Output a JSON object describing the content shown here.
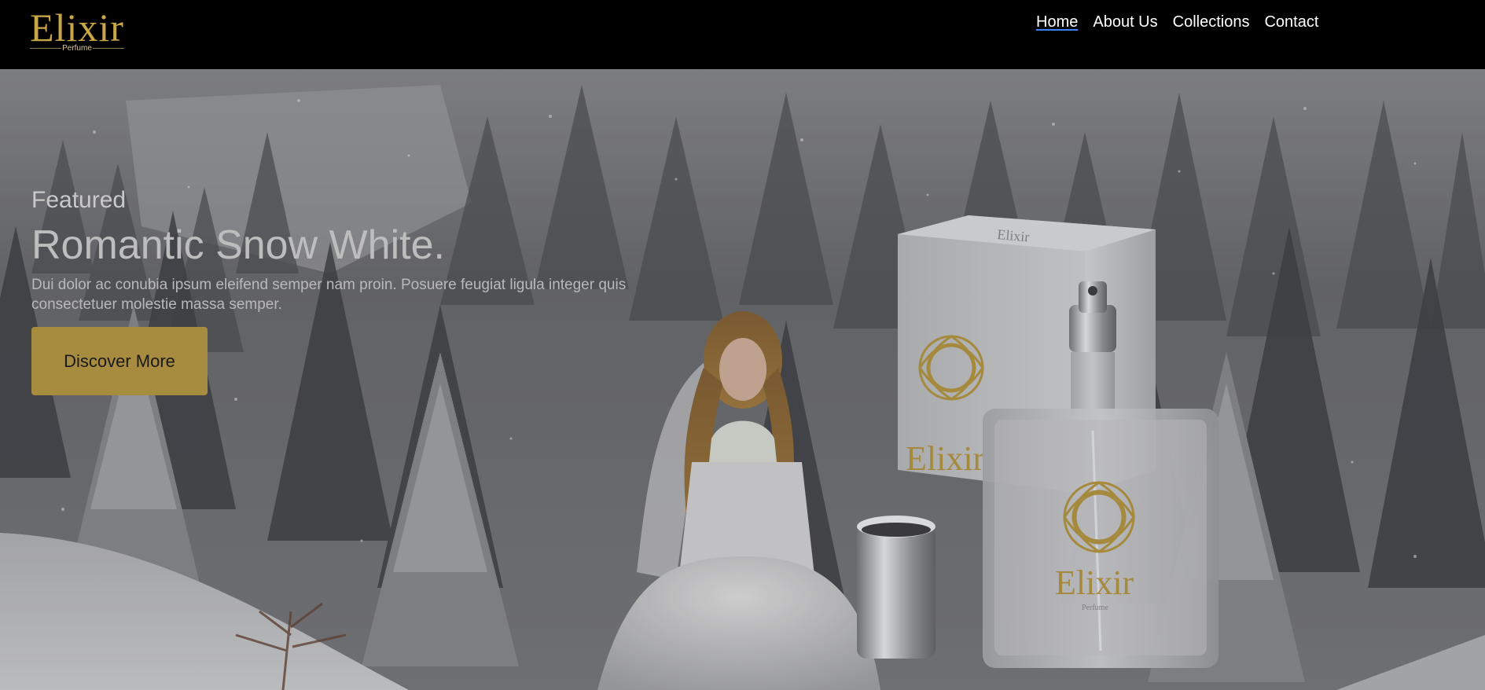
{
  "brand": {
    "name": "Elixir",
    "tagline": "Perfume",
    "color": "#c9a646"
  },
  "nav": {
    "items": [
      {
        "label": "Home",
        "active": true
      },
      {
        "label": "About Us",
        "active": false
      },
      {
        "label": "Collections",
        "active": false
      },
      {
        "label": "Contact",
        "active": false
      }
    ],
    "active_underline_color": "#3b82f6"
  },
  "hero": {
    "eyebrow": "Featured",
    "title": "Romantic Snow White.",
    "description": "Dui dolor ac conubia ipsum eleifend semper nam proin. Posuere feugiat ligula integer quis consectetuer molestie massa semper.",
    "cta_label": "Discover More",
    "cta_color": "#a78b3e",
    "box_brand": "Elixir",
    "bottle_brand": "Elixir",
    "bottle_sub": "Perfume"
  }
}
